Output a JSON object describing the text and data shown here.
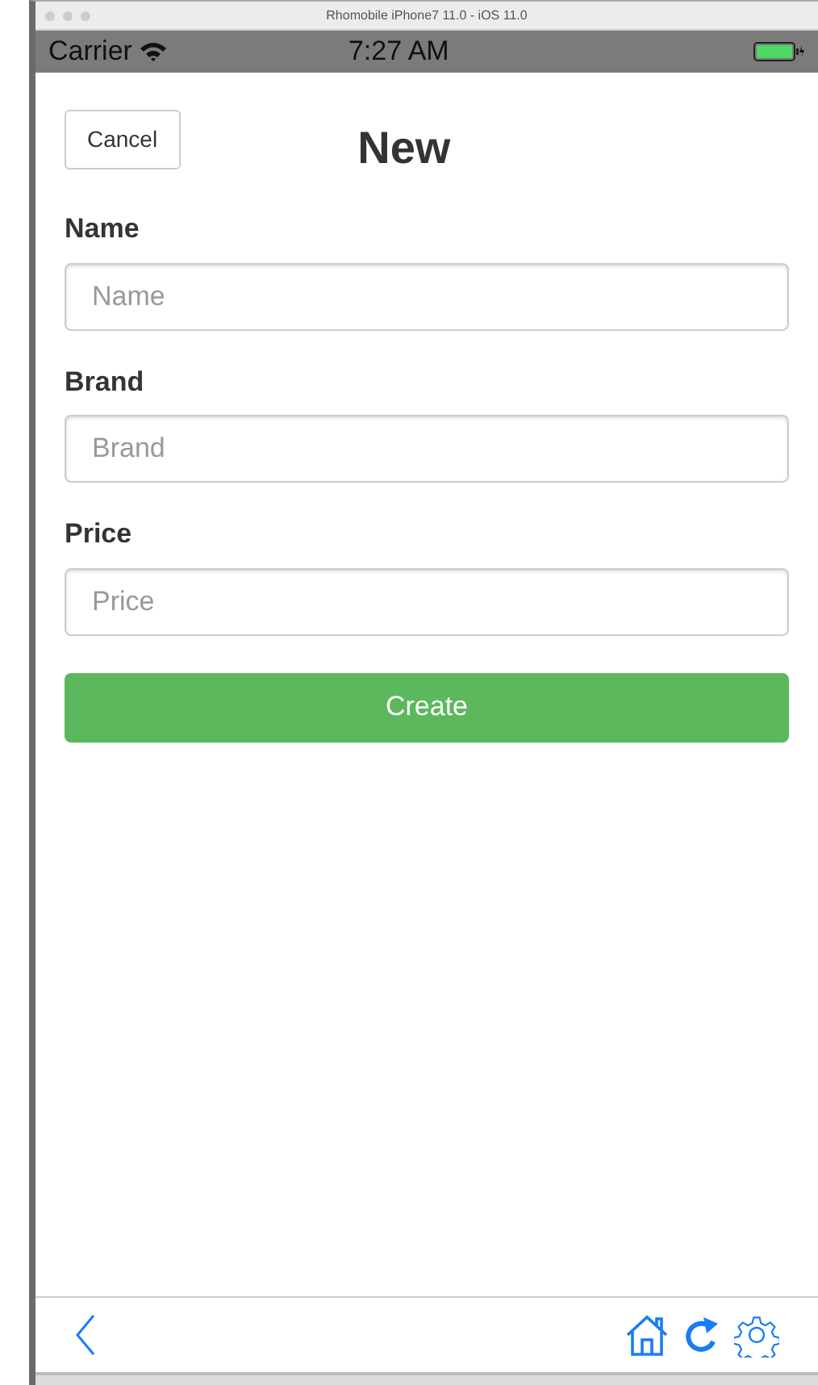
{
  "window": {
    "title": "Rhomobile iPhone7 11.0 - iOS 11.0"
  },
  "status_bar": {
    "carrier": "Carrier",
    "time": "7:27 AM"
  },
  "header": {
    "cancel": "Cancel",
    "title": "New"
  },
  "fields": [
    {
      "label": "Name",
      "placeholder": "Name"
    },
    {
      "label": "Brand",
      "placeholder": "Brand"
    },
    {
      "label": "Price",
      "placeholder": "Price"
    }
  ],
  "submit": "Create"
}
